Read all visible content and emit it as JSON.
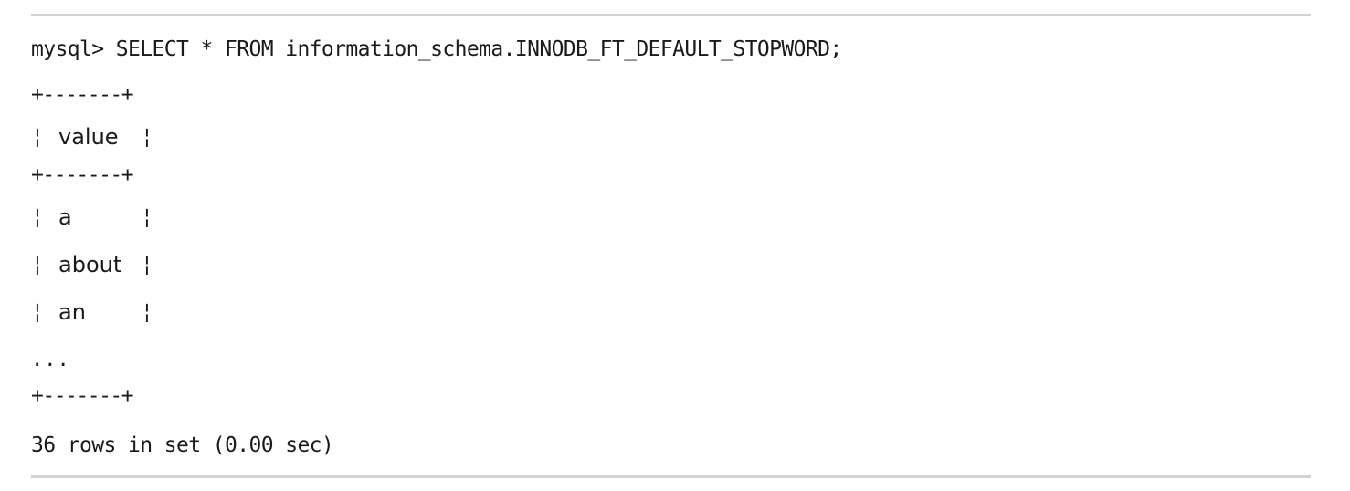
{
  "terminal": {
    "prompt_line": "mysql> SELECT * FROM information_schema.INNODB_FT_DEFAULT_STOPWORD;",
    "border": "+-------+",
    "bar": "¦",
    "header": "value",
    "rows": [
      "a",
      "about",
      "an"
    ],
    "ellipsis": "...",
    "footer": "36 rows in set (0.00 sec)"
  }
}
